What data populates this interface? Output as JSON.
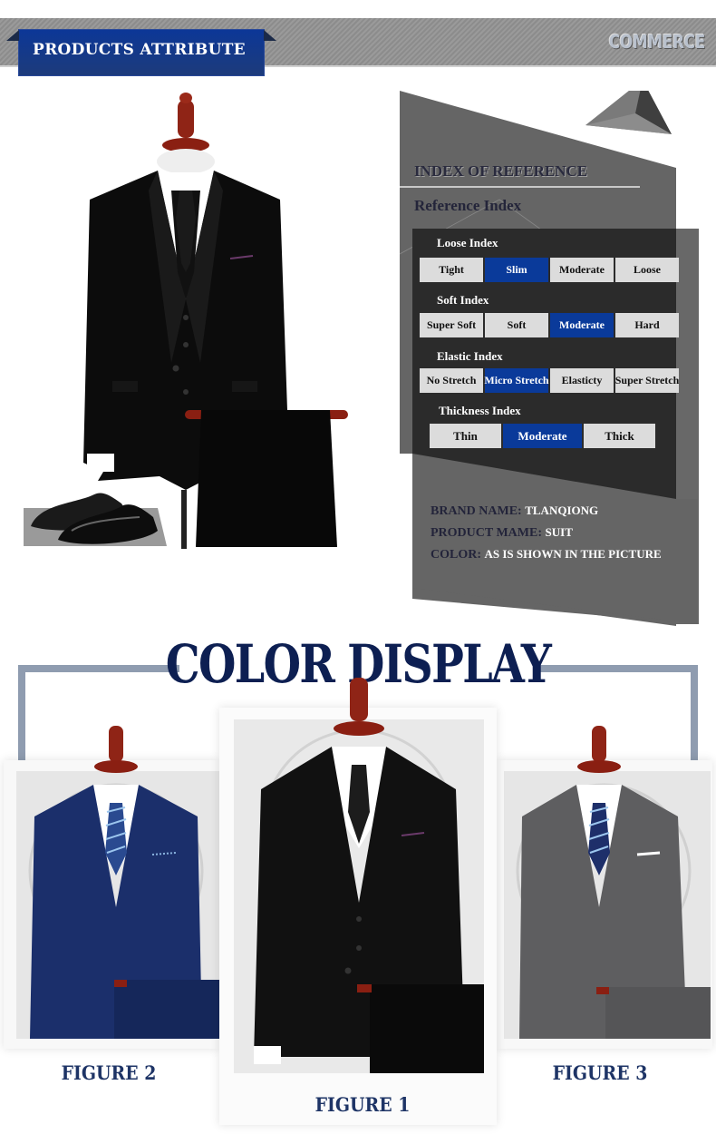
{
  "header": {
    "title": "PRODUCTS ATTRIBUTE",
    "right_label": "COMMERCE"
  },
  "reference": {
    "title": "INDEX OF REFERENCE",
    "subtitle": "Reference Index",
    "indices": [
      {
        "label": "Loose Index",
        "options": [
          "Tight",
          "Slim",
          "Moderate",
          "Loose"
        ],
        "selected": "Slim"
      },
      {
        "label": "Soft Index",
        "options": [
          "Super Soft",
          "Soft",
          "Moderate",
          "Hard"
        ],
        "selected": "Moderate"
      },
      {
        "label": "Elastic Index",
        "options": [
          "No Stretch",
          "Micro Stretch",
          "Elasticty",
          "Super Stretch"
        ],
        "selected": "Micro Stretch"
      },
      {
        "label": "Thickness Index",
        "options": [
          "Thin",
          "Moderate",
          "Thick"
        ],
        "selected": "Moderate"
      }
    ],
    "info": [
      {
        "key": "BRAND NAME:",
        "value": "TLANQIONG"
      },
      {
        "key": "PRODUCT MAME:",
        "value": "SUIT"
      },
      {
        "key": "COLOR:",
        "value": "AS IS SHOWN IN THE PICTURE"
      }
    ]
  },
  "color_display": {
    "title": "COLOR DISPLAY",
    "figures": [
      {
        "label": "FIGURE 2",
        "suit_color": "#1b2f6b",
        "tie": "striped-blue"
      },
      {
        "label": "FIGURE 1",
        "suit_color": "#111111",
        "tie": "black"
      },
      {
        "label": "FIGURE 3",
        "suit_color": "#5e5e60",
        "tie": "striped-blue"
      }
    ]
  },
  "colors": {
    "brand_blue": "#0a3a9a",
    "title_navy": "#0d1f52",
    "panel_dark": "#2b2b2b",
    "panel_gray": "#656565"
  }
}
